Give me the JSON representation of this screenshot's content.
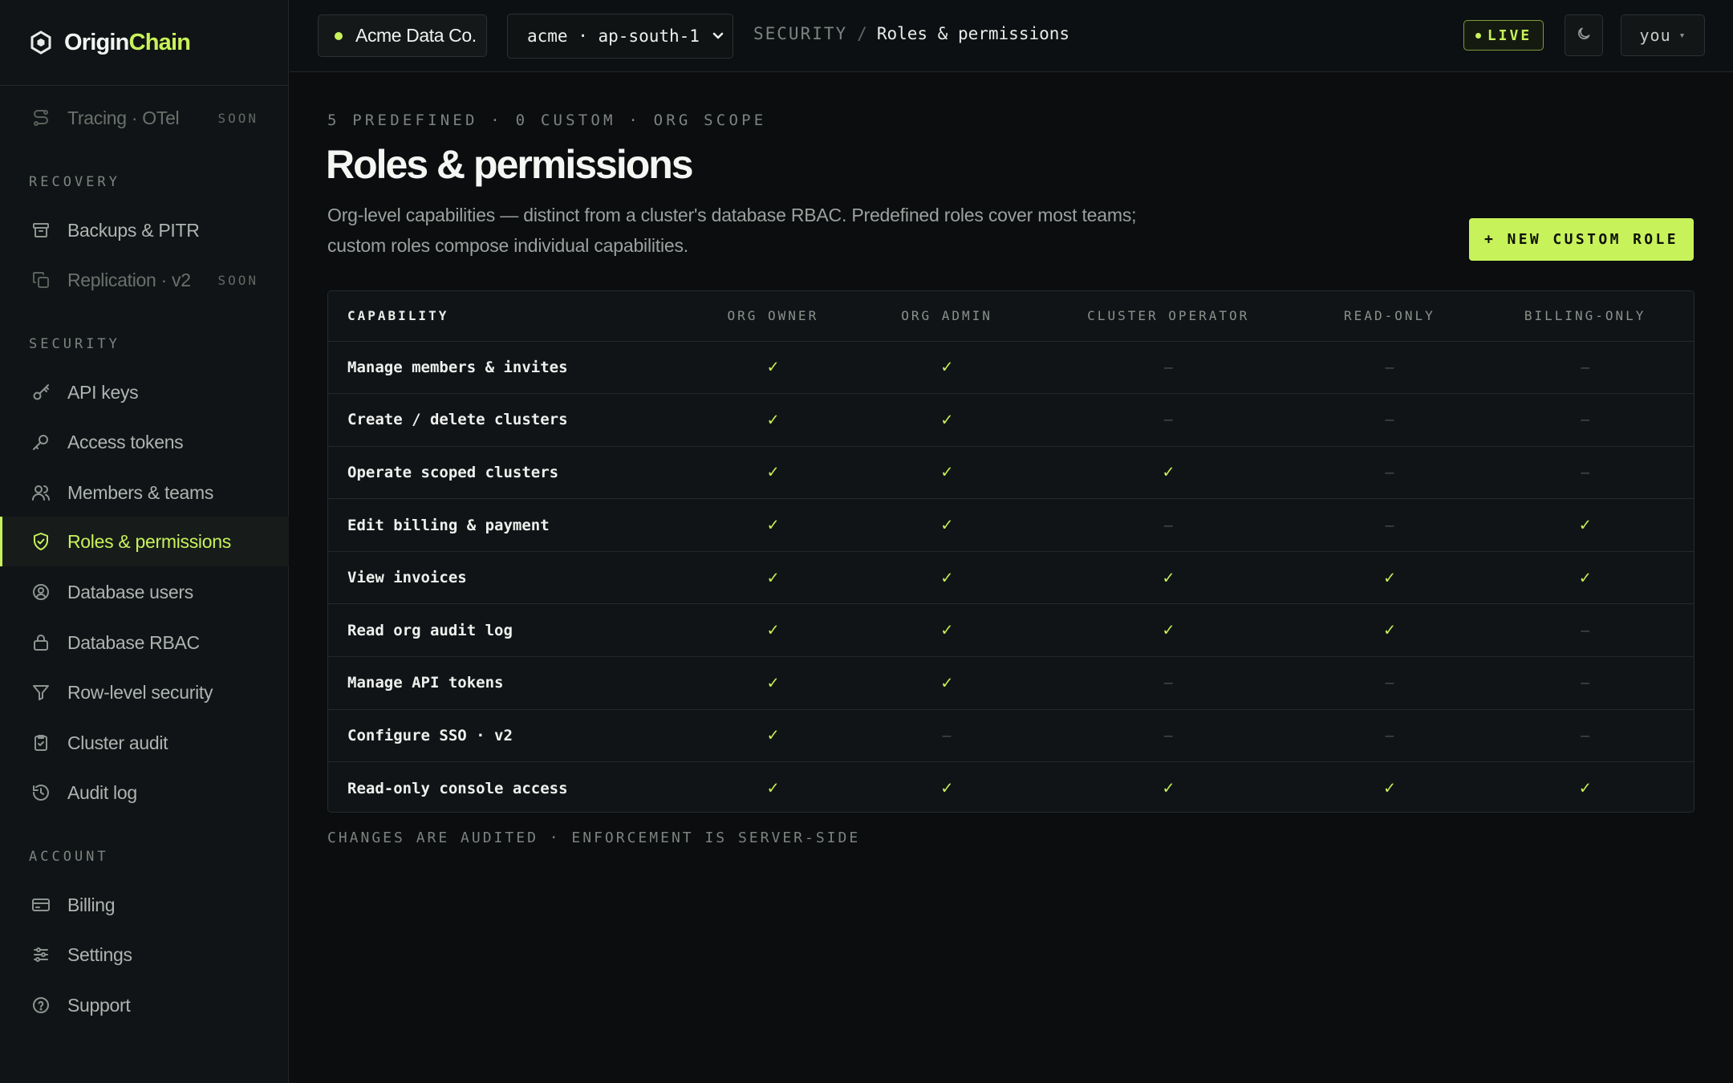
{
  "brand": {
    "name_part1": "Origin",
    "name_part2": "Chain",
    "accent_color": "#c8f25a"
  },
  "sidebar": {
    "top_item": {
      "label": "Tracing · OTel",
      "badge": "SOON",
      "icon": "tracing-icon"
    },
    "sections": [
      {
        "label": "RECOVERY",
        "items": [
          {
            "label": "Backups & PITR",
            "icon": "archive-icon"
          },
          {
            "label": "Replication · v2",
            "badge": "SOON",
            "icon": "copy-icon"
          }
        ]
      },
      {
        "label": "SECURITY",
        "items": [
          {
            "label": "API keys",
            "icon": "key-icon"
          },
          {
            "label": "Access tokens",
            "icon": "token-icon"
          },
          {
            "label": "Members & teams",
            "icon": "users-icon"
          },
          {
            "label": "Roles & permissions",
            "icon": "shield-check-icon",
            "active": true
          },
          {
            "label": "Database users",
            "icon": "user-circle-icon"
          },
          {
            "label": "Database RBAC",
            "icon": "lock-icon"
          },
          {
            "label": "Row-level security",
            "icon": "filter-icon"
          },
          {
            "label": "Cluster audit",
            "icon": "clipboard-check-icon"
          },
          {
            "label": "Audit log",
            "icon": "history-icon"
          }
        ]
      },
      {
        "label": "ACCOUNT",
        "items": [
          {
            "label": "Billing",
            "icon": "credit-card-icon"
          },
          {
            "label": "Settings",
            "icon": "sliders-icon"
          },
          {
            "label": "Support",
            "icon": "help-circle-icon"
          }
        ]
      }
    ]
  },
  "topbar": {
    "org_name": "Acme Data Co.",
    "region": "acme · ap-south-1",
    "breadcrumb": {
      "section": "SECURITY",
      "separator": "/",
      "page": "Roles & permissions"
    },
    "live_label": "LIVE",
    "user_label": "you",
    "user_caret": "▾"
  },
  "main": {
    "eyebrow": "5 PREDEFINED · 0 CUSTOM · ORG SCOPE",
    "title": "Roles & permissions",
    "description_line1": "Org-level capabilities — distinct from a cluster's database RBAC. Predefined roles cover most teams;",
    "description_line2": "custom roles compose individual capabilities.",
    "new_role_button": "+ NEW CUSTOM ROLE",
    "footnote": "CHANGES ARE AUDITED · ENFORCEMENT IS SERVER-SIDE"
  },
  "permissions_table": {
    "columns": [
      "CAPABILITY",
      "ORG OWNER",
      "ORG ADMIN",
      "CLUSTER OPERATOR",
      "READ-ONLY",
      "BILLING-ONLY"
    ],
    "check_glyph": "✓",
    "dash_glyph": "—",
    "rows": [
      {
        "capability": "Manage members & invites",
        "grants": [
          true,
          true,
          false,
          false,
          false
        ]
      },
      {
        "capability": "Create / delete clusters",
        "grants": [
          true,
          true,
          false,
          false,
          false
        ]
      },
      {
        "capability": "Operate scoped clusters",
        "grants": [
          true,
          true,
          true,
          false,
          false
        ]
      },
      {
        "capability": "Edit billing & payment",
        "grants": [
          true,
          true,
          false,
          false,
          true
        ]
      },
      {
        "capability": "View invoices",
        "grants": [
          true,
          true,
          true,
          true,
          true
        ]
      },
      {
        "capability": "Read org audit log",
        "grants": [
          true,
          true,
          true,
          true,
          false
        ]
      },
      {
        "capability": "Manage API tokens",
        "grants": [
          true,
          true,
          false,
          false,
          false
        ]
      },
      {
        "capability": "Configure SSO · v2",
        "grants": [
          true,
          false,
          false,
          false,
          false
        ]
      },
      {
        "capability": "Read-only console access",
        "grants": [
          true,
          true,
          true,
          true,
          true
        ]
      }
    ]
  }
}
